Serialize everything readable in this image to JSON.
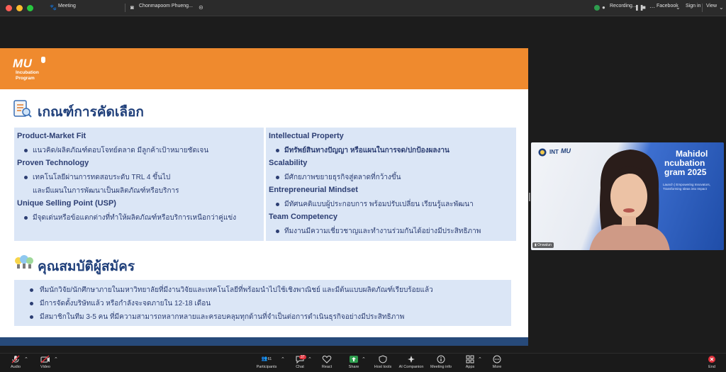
{
  "topbar": {
    "meeting_label": "Meeting",
    "speaker_label": "Chonmapoom Phueng...",
    "recording_label": "Recording...",
    "facebook_label": "Facebook",
    "signin_label": "Sign in",
    "view_label": "View"
  },
  "slide": {
    "logo_main": "MU",
    "logo_sub_1": "Incubation",
    "logo_sub_2": "Program",
    "section1_title": "เกณฑ์การคัดเลือก",
    "section2_title": "คุณสมบัติผู้สมัคร",
    "left_panel": [
      {
        "head": "Product-Market Fit",
        "items": [
          "แนวคิด/ผลิตภัณฑ์ตอบโจทย์ตลาด มีลูกค้าเป้าหมายชัดเจน"
        ]
      },
      {
        "head": "Proven Technology",
        "items": [
          "เทคโนโลยีผ่านการทดสอบระดับ TRL 4 ขึ้นไป",
          "และมีแผนในการพัฒนาเป็นผลิตภัณฑ์หรือบริการ"
        ]
      },
      {
        "head": "Unique Selling Point (USP)",
        "items": [
          "มีจุดเด่นหรือข้อแตกต่างที่ทำให้ผลิตภัณฑ์หรือบริการเหนือกว่าคู่แข่ง"
        ]
      }
    ],
    "right_panel": [
      {
        "head": "Intellectual Property",
        "items": [
          "มีทรัพย์สินทางปัญญา หรือแผนในการจด/ปกป้องผลงาน"
        ]
      },
      {
        "head": "Scalability",
        "items": [
          "มีศักยภาพขยายธุรกิจสู่ตลาดที่กว้างขึ้น"
        ]
      },
      {
        "head": "Entrepreneurial Mindset",
        "items": [
          "มีทัศนคติแบบผู้ประกอบการ พร้อมปรับเปลี่ยน เรียนรู้และพัฒนา"
        ]
      },
      {
        "head": "Team Competency",
        "items": [
          "ทีมงานมีความเชี่ยวชาญและทำงานร่วมกันได้อย่างมีประสิทธิภาพ"
        ]
      }
    ],
    "qualifications": [
      "ทีมนักวิจัย/นักศึกษาภายในมหาวิทยาลัยที่มีงานวิจัยและเทคโนโลยีที่พร้อมนำไปใช้เชิงพาณิชย์ และมีต้นแบบผลิตภัณฑ์เรียบร้อยแล้ว",
      "มีการจัดตั้งบริษัทแล้ว หรือกำลังจะจดภายใน 12-18 เดือน",
      "มีสมาชิกในทีม 3-5 คน ที่มีความสามารถหลากหลายและครอบคลุมทุกด้านที่จำเป็นต่อการดำเนินธุรกิจอย่างมีประสิทธิภาพ"
    ]
  },
  "video": {
    "title_1": "Mahidol",
    "title_2": "ncubation",
    "title_3": "gram 2025",
    "sub_1": "Launch | Empowering Innovators,",
    "sub_2": "Transforming Ideas into Impact",
    "participant_name": "Onwalun",
    "logo_text": "MU"
  },
  "toolbar": {
    "audio": "Audio",
    "video": "Video",
    "participants": "Participants",
    "participants_count": "61",
    "chat": "Chat",
    "chat_badge": "37",
    "react": "React",
    "share": "Share",
    "host_tools": "Host tools",
    "ai_companion": "AI Companion",
    "meeting_info": "Meeting info",
    "apps": "Apps",
    "more": "More",
    "end": "End"
  },
  "colors": {
    "slide_header": "#ef8a2e",
    "slide_footer": "#274a7a",
    "panel": "#dbe6f6",
    "title": "#1f3f7a",
    "end_button": "#e0323c",
    "share_button": "#2e9d4e"
  }
}
